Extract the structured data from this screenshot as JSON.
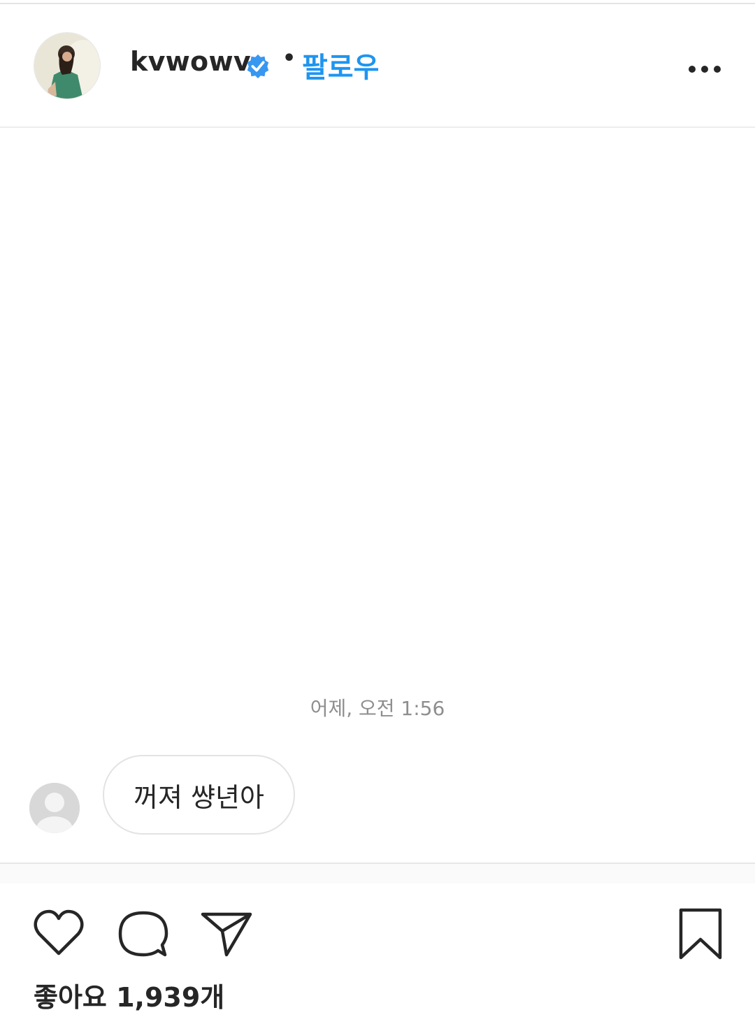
{
  "header": {
    "username": "kvwowv",
    "separator": "•",
    "follow_label": "팔로우"
  },
  "post": {
    "timestamp": "어제, 오전 1:56",
    "message": "꺼져 썅년아"
  },
  "actions": {
    "icons": [
      "heart-icon",
      "comment-icon",
      "send-icon",
      "bookmark-icon"
    ]
  },
  "likes": {
    "label": "좋아요 1,939개"
  },
  "colors": {
    "accent": "#1e95f0",
    "verified": "#3897f0",
    "text": "#262626",
    "muted": "#8e8e8e"
  }
}
